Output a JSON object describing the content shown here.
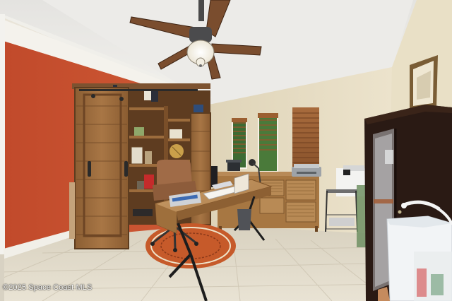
{
  "photo": {
    "watermark": "©2025 Space Coast MLS",
    "palette": {
      "accent_wall": "#c9512f",
      "wall": "#e6dcc2",
      "ceiling": "#eeedea",
      "wood": "#9a6b3c",
      "floor_tile": "#ddd6c6",
      "rug": "#c65a2a",
      "cabinet_dark": "#2a1a14"
    }
  }
}
